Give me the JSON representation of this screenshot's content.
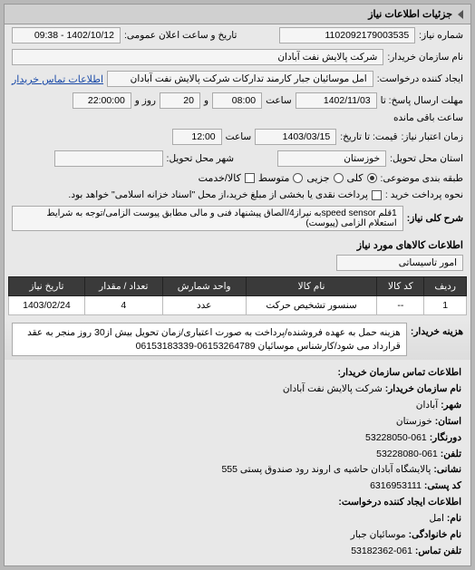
{
  "panel_title": "جزئیات اطلاعات نیاز",
  "fields": {
    "req_no_lbl": "شماره نیاز:",
    "req_no": "1102092179003535",
    "pub_date_lbl": "تاریخ و ساعت اعلان عمومی:",
    "pub_date": "1402/10/12 - 09:38",
    "buyer_lbl": "نام سازمان خریدار:",
    "buyer": "شرکت پالایش نفت آبادان",
    "creator_lbl": "ایجاد کننده درخواست:",
    "creator": "امل موسائیان جبار کارمند تدارکات شرکت پالایش نفت آبادان",
    "contact_lbl": "اطلاعات تماس خریدار",
    "resp_until_lbl": "مهلت ارسال پاسخ: تا",
    "resp_date": "1402/11/03",
    "time_lbl": "ساعت",
    "resp_time": "08:00",
    "and_lbl": "و",
    "day_lbl": "روز و",
    "days_rem": "20",
    "rem_time": "22:00:00",
    "rem_suffix": "ساعت باقی مانده",
    "valid_lbl": "زمان اعتبار نیاز:",
    "quote_until_lbl": "قیمت: تا تاریخ:",
    "quote_date": "1403/03/15",
    "quote_time": "12:00",
    "deliv_prov_lbl": "استان محل تحویل:",
    "deliv_prov": "خوزستان",
    "deliv_city_lbl": "شهر محل تحویل:",
    "cat_lbl": "طبقه بندی موضوعی:",
    "cat_all": "کلی",
    "cat_part": "جزیی",
    "cat_mid": "متوسط",
    "cat_item": "کالا/خدمت",
    "pay_lbl": "نحوه پرداخت خرید :",
    "pay_note": "پرداخت نقدی یا بخشی از مبلغ خرید،از محل \"اسناد خزانه اسلامی\" خواهد بود.",
    "title_lbl": "شرح کلی نیاز:",
    "title_val": "1قلم speed sensorبه نیراز4/الصاق پیشنهاد فنی و مالی مطابق پیوست الزامی/توجه به شرایط استعلام الزامی (پیوست)",
    "goods_header": "اطلاعات کالاهای مورد نیاز",
    "amr_lbl": "امور تاسیساتی",
    "cols": {
      "row": "ردیف",
      "code": "کد کالا",
      "name": "نام کالا",
      "unit": "واحد شمارش",
      "qty": "تعداد / مقدار",
      "date": "تاریخ نیاز"
    },
    "item": {
      "row": "1",
      "code": "--",
      "name": "سنسور تشخیص حرکت",
      "unit": "عدد",
      "qty": "4",
      "date": "1403/02/24"
    },
    "ship_lbl": "هزینه خریدار:",
    "ship_note": "هزینه حمل به عهده فروشنده/پرداخت به صورت اعتباری/زمان تحویل بیش از30 روز منجر به عقد قرارداد می شود/کارشناس موسائیان 06153264789-06153183339",
    "contact_title": "اطلاعات تماس سازمان خریدار:",
    "c_org_lbl": "نام سازمان خریدار:",
    "c_org": "شرکت پالایش نفت آبادان",
    "c_city_lbl": "شهر:",
    "c_city": "آبادان",
    "c_prov_lbl": "استان:",
    "c_prov": "خوزستان",
    "c_fax_lbl": "دورنگار:",
    "c_fax": "061-53228050",
    "c_tel_lbl": "تلفن:",
    "c_tel": "061-53228080",
    "c_addr_lbl": "نشانی:",
    "c_addr": "پالایشگاه آبادان حاشیه ی اروند رود صندوق پستی 555",
    "c_post_lbl": "کد پستی:",
    "c_post": "6316953111",
    "c_req_lbl": "اطلاعات ایجاد کننده درخواست:",
    "c_name_lbl": "نام:",
    "c_name": "امل",
    "c_fam_lbl": "نام خانوادگی:",
    "c_fam": "موسائیان جبار",
    "c_ptel_lbl": "تلفن تماس:",
    "c_ptel": "061-53182362"
  }
}
